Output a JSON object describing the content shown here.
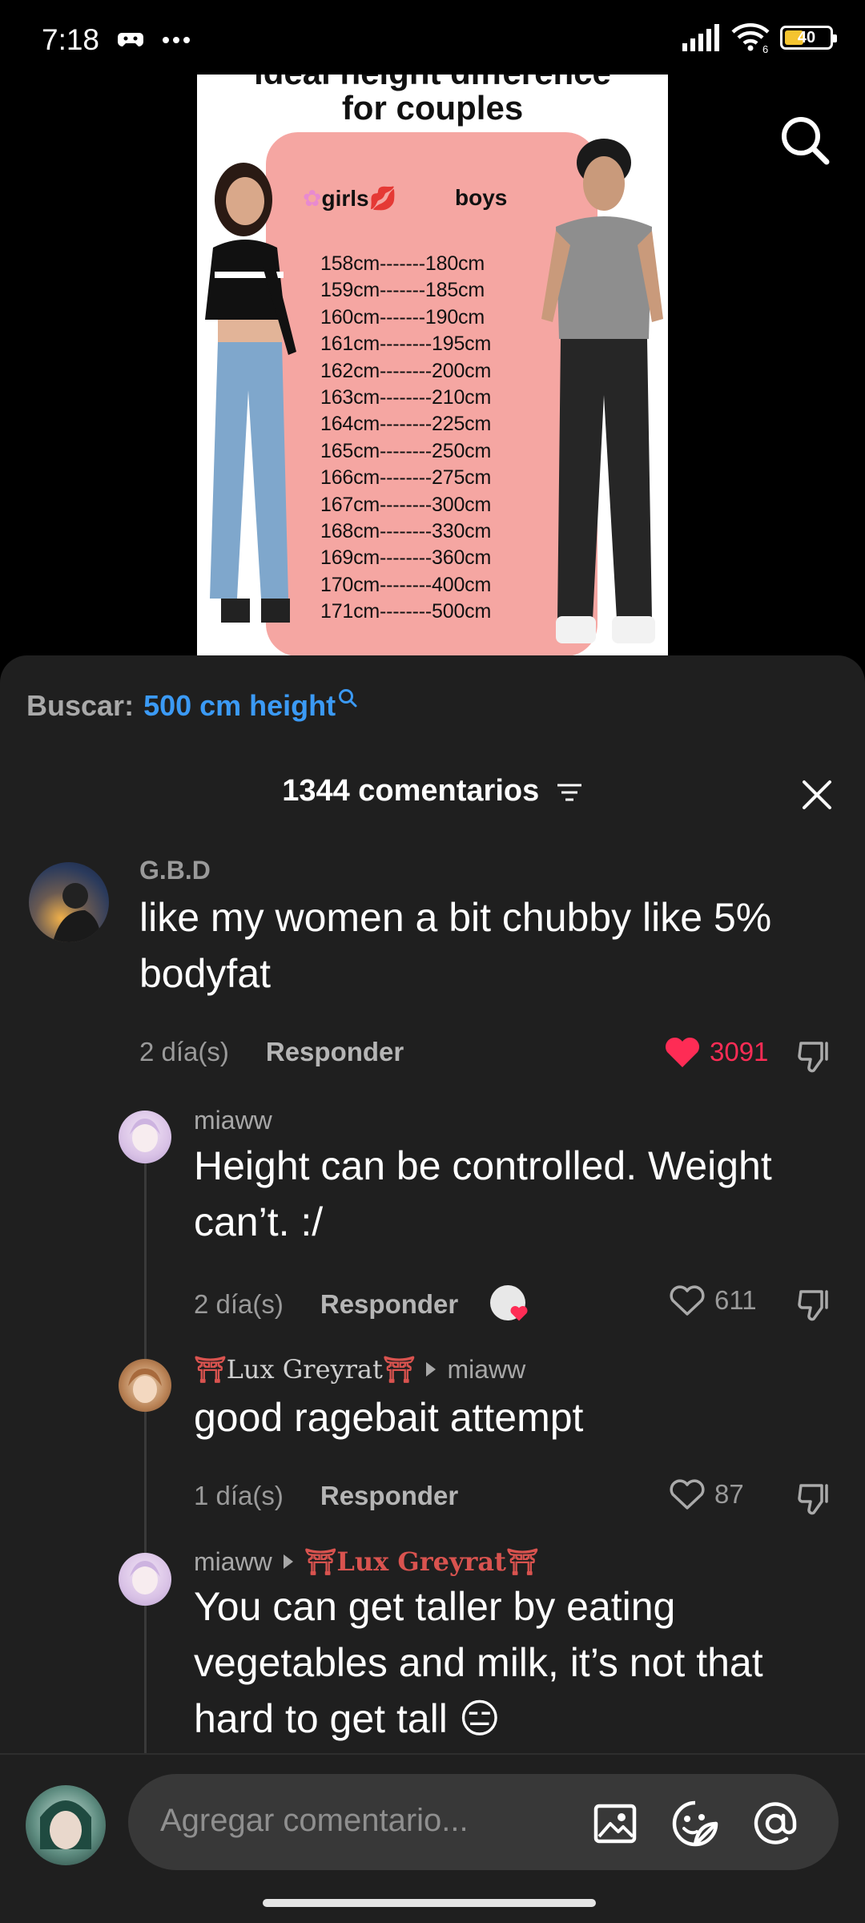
{
  "status": {
    "time": "7:18",
    "battery": "40",
    "signal_suffix": "6"
  },
  "video": {
    "title_line1": "ideal height difference",
    "title_line2": "for couples",
    "col_girls": "girls",
    "col_boys": "boys",
    "rows": [
      "158cm-------180cm",
      "159cm-------185cm",
      "160cm-------190cm",
      "161cm--------195cm",
      "162cm--------200cm",
      "163cm--------210cm",
      "164cm--------225cm",
      "165cm--------250cm",
      "166cm--------275cm",
      "167cm--------300cm",
      "168cm--------330cm",
      "169cm--------360cm",
      "170cm--------400cm",
      "171cm--------500cm"
    ]
  },
  "search": {
    "label": "Buscar:",
    "query": "500 cm height"
  },
  "comments_header": {
    "count_text": "1344 comentarios"
  },
  "comments": [
    {
      "username": "G.B.D",
      "text": "like my women a bit chubby like 5% bodyfat",
      "time": "2 día(s)",
      "reply_label": "Responder",
      "likes": "3091",
      "liked": true
    },
    {
      "username": "miaww",
      "text": "Height can be controlled. Weight can’t. :/",
      "time": "2 día(s)",
      "reply_label": "Responder",
      "likes": "611",
      "liked": false
    },
    {
      "username": "Lux Greyrat",
      "reply_to": "miaww",
      "text": "good ragebait attempt",
      "time": "1 día(s)",
      "reply_label": "Responder",
      "likes": "87",
      "liked": false
    },
    {
      "username": "miaww",
      "reply_to": "Lux Greyrat",
      "text": "You can get taller by eating vegetables and milk, it’s not that hard to get tall 😑"
    }
  ],
  "composer": {
    "placeholder": "Agregar comentario..."
  },
  "colors": {
    "accent_red": "#fe2c55",
    "link_blue": "#3b9af5",
    "sheet_bg": "#1f1f1f"
  }
}
